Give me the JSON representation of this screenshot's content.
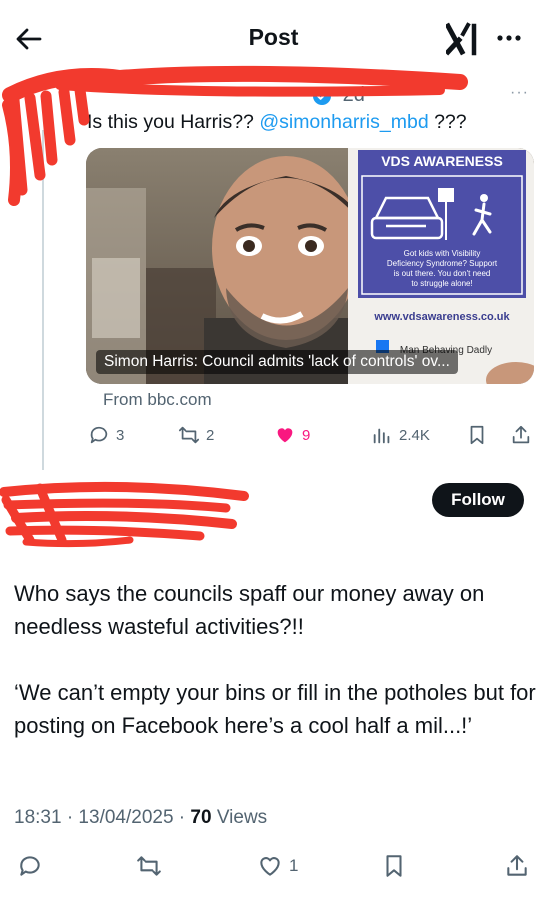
{
  "header": {
    "title": "Post",
    "back_icon": "arrow-left-icon",
    "logo_icon": "xai-logo-icon",
    "more_icon": "more-horizontal-icon"
  },
  "quoted": {
    "time_sep": "·",
    "age": "2d",
    "more": "···",
    "text_prefix": "Is this you Harris?? ",
    "mention": "@simonharris_mbd",
    "text_suffix": " ???",
    "card": {
      "sign_title": "VDS AWARENESS",
      "sign_text": [
        "Got kids with Visibility",
        "Deficiency Syndrome? Support",
        "is out there. You don't need",
        "to struggle alone!"
      ],
      "sign_url": "www.vdsawareness.co.uk",
      "sign_brand": "Man Behaving Dadly",
      "caption": "Simon Harris: Council admits 'lack of controls' ov..."
    },
    "source": "From bbc.com",
    "actions": {
      "replies": "3",
      "reposts": "2",
      "likes": "9",
      "views": "2.4K"
    }
  },
  "follow_label": "Follow",
  "tweet": {
    "paragraphs": [
      "Who says the councils spaff our money away on needless wasteful activities?!!",
      "‘We can’t empty your bins or fill in the potholes but for posting on Facebook here’s a cool half a mil...!’"
    ],
    "time": "18:31 · 13/04/2025 · ",
    "views_count": "70",
    "views_label": " Views",
    "likes": "1"
  },
  "colors": {
    "accent": "#1d9bf0",
    "like_active": "#f91880",
    "muted": "#536471",
    "redaction": "#f23a2e"
  }
}
